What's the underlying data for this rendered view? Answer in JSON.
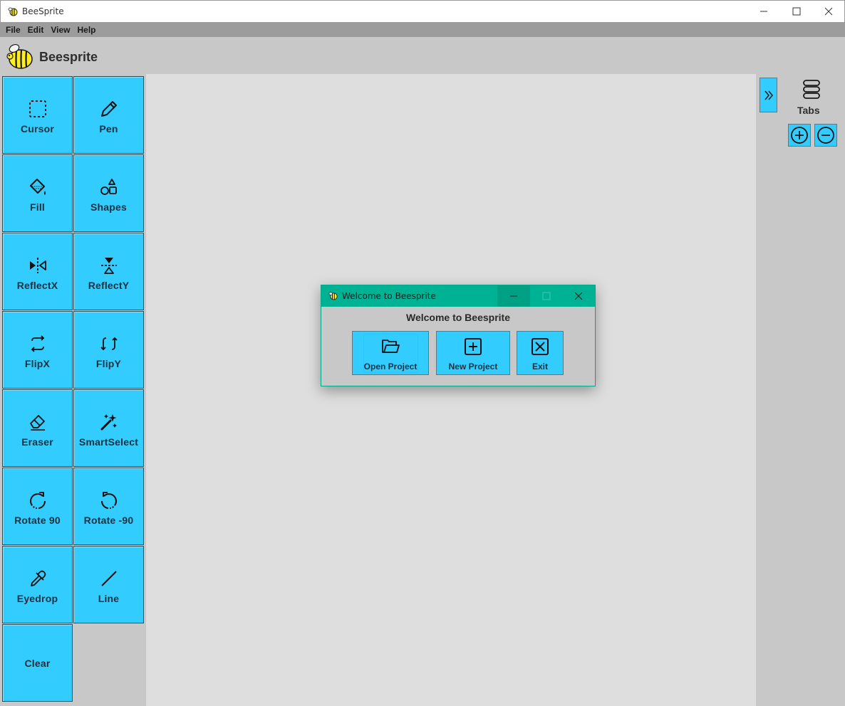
{
  "window": {
    "title": "BeeSprite"
  },
  "menubar": {
    "items": [
      "File",
      "Edit",
      "View",
      "Help"
    ]
  },
  "header": {
    "app_name": "Beesprite"
  },
  "tools": [
    {
      "label": "Cursor",
      "icon": "dashed-select-icon"
    },
    {
      "label": "Pen",
      "icon": "pencil-icon"
    },
    {
      "label": "Fill",
      "icon": "paint-bucket-icon"
    },
    {
      "label": "Shapes",
      "icon": "shapes-icon"
    },
    {
      "label": "ReflectX",
      "icon": "reflect-x-icon"
    },
    {
      "label": "ReflectY",
      "icon": "reflect-y-icon"
    },
    {
      "label": "FlipX",
      "icon": "flip-x-icon"
    },
    {
      "label": "FlipY",
      "icon": "flip-y-icon"
    },
    {
      "label": "Eraser",
      "icon": "eraser-icon"
    },
    {
      "label": "SmartSelect",
      "icon": "magic-wand-icon"
    },
    {
      "label": "Rotate 90",
      "icon": "rotate-cw-icon"
    },
    {
      "label": "Rotate -90",
      "icon": "rotate-ccw-icon"
    },
    {
      "label": "Eyedrop",
      "icon": "eyedropper-icon"
    },
    {
      "label": "Line",
      "icon": "line-icon"
    },
    {
      "label": "Clear",
      "icon": ""
    }
  ],
  "right_panel": {
    "tabs_label": "Tabs"
  },
  "dialog": {
    "title": "Welcome to Beesprite",
    "heading": "Welcome to Beesprite",
    "buttons": {
      "open": "Open Project",
      "new": "New Project",
      "exit": "Exit"
    }
  },
  "colors": {
    "tool_button": "#33ccff",
    "dialog_titlebar": "#00b294",
    "canvas_bg": "#dedede",
    "panel_bg": "#c8c8c8",
    "menubar_bg": "#9c9c9c"
  }
}
